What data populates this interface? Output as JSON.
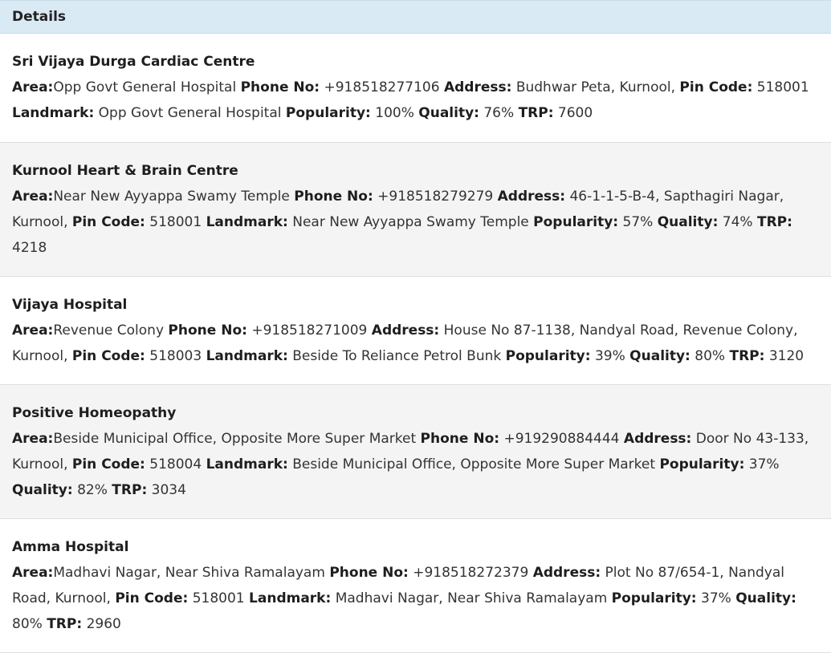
{
  "header": {
    "title": "Details"
  },
  "labels": {
    "area": "Area:",
    "phone": "Phone No:",
    "address": "Address:",
    "pin": "Pin Code:",
    "landmark": "Landmark:",
    "popularity": "Popularity:",
    "quality": "Quality:",
    "trp": "TRP:"
  },
  "entries": [
    {
      "name": "Sri Vijaya Durga Cardiac Centre",
      "area": "Opp Govt General Hospital",
      "phone": "+918518277106",
      "address": "Budhwar Peta, Kurnool,",
      "pin": "518001",
      "landmark": "Opp Govt General Hospital",
      "popularity": "100%",
      "quality": "76%",
      "trp": "7600"
    },
    {
      "name": "Kurnool Heart & Brain Centre",
      "area": "Near New Ayyappa Swamy Temple",
      "phone": "+918518279279",
      "address": "46-1-1-5-B-4, Sapthagiri Nagar, Kurnool,",
      "pin": "518001",
      "landmark": "Near New Ayyappa Swamy Temple",
      "popularity": "57%",
      "quality": "74%",
      "trp": "4218"
    },
    {
      "name": "Vijaya Hospital",
      "area": "Revenue Colony",
      "phone": "+918518271009",
      "address": "House No 87-1138, Nandyal Road, Revenue Colony, Kurnool,",
      "pin": "518003",
      "landmark": "Beside To Reliance Petrol Bunk",
      "popularity": "39%",
      "quality": "80%",
      "trp": "3120"
    },
    {
      "name": "Positive Homeopathy",
      "area": "Beside Municipal Office, Opposite More Super Market",
      "phone": "+919290884444",
      "address": "Door No 43-133, Kurnool,",
      "pin": "518004",
      "landmark": "Beside Municipal Office, Opposite More Super Market",
      "popularity": "37%",
      "quality": "82%",
      "trp": "3034"
    },
    {
      "name": "Amma Hospital",
      "area": "Madhavi Nagar, Near Shiva Ramalayam",
      "phone": "+918518272379",
      "address": "Plot No 87/654-1, Nandyal Road, Kurnool,",
      "pin": "518001",
      "landmark": "Madhavi Nagar, Near Shiva Ramalayam",
      "popularity": "37%",
      "quality": "80%",
      "trp": "2960"
    }
  ]
}
